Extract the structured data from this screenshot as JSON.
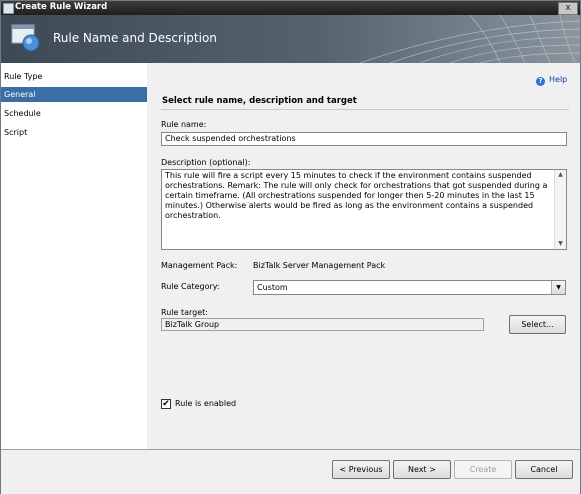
{
  "window": {
    "title": "Create Rule Wizard",
    "close_glyph": "x"
  },
  "banner": {
    "title": "Rule Name and Description"
  },
  "sidebar": {
    "items": [
      {
        "label": "Rule Type",
        "selected": false
      },
      {
        "label": "General",
        "selected": true
      },
      {
        "label": "Schedule",
        "selected": false
      },
      {
        "label": "Script",
        "selected": false
      }
    ]
  },
  "help": {
    "label": "Help",
    "icon": "help-icon"
  },
  "section": {
    "heading": "Select rule name, description and target"
  },
  "rule_name": {
    "label": "Rule name:",
    "value": "Check suspended orchestrations"
  },
  "description": {
    "label": "Description (optional):",
    "value": "This rule will fire a script every 15 minutes to check if the environment contains suspended orchestrations. Remark: The rule will only check for orchestrations that got suspended during a certain timeframe. (All orchestrations suspended for longer then 5-20 minutes in the last 15 minutes.) Otherwise alerts would be fired as long as the environment contains a suspended orchestration."
  },
  "management_pack": {
    "label": "Management Pack:",
    "value": "BizTalk Server Management Pack"
  },
  "rule_category": {
    "label": "Rule Category:",
    "value": "Custom"
  },
  "rule_target": {
    "label": "Rule target:",
    "value": "BizTalk Group",
    "select_label": "Select..."
  },
  "enabled": {
    "label": "Rule is enabled",
    "checked": true,
    "check_glyph": "✔"
  },
  "buttons": {
    "previous": "< Previous",
    "next": "Next >",
    "create": "Create",
    "cancel": "Cancel"
  }
}
